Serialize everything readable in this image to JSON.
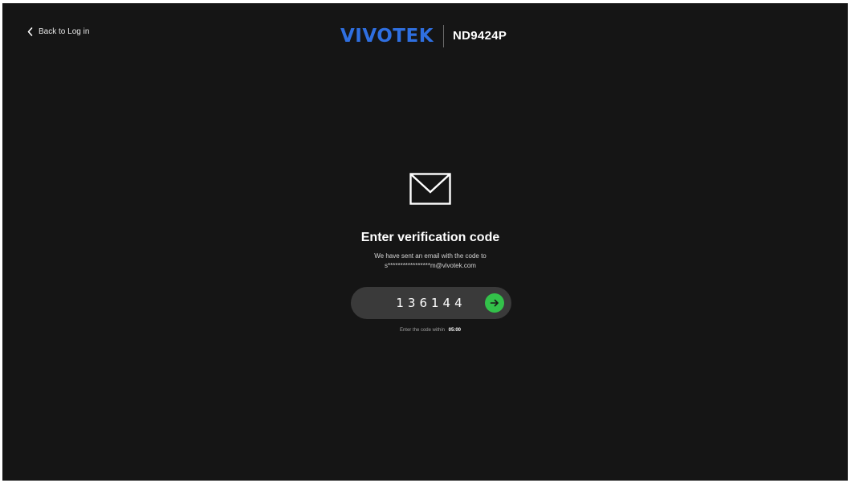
{
  "nav": {
    "back_label": "Back to Log in",
    "back_icon": "chevron-left-icon"
  },
  "header": {
    "brand": "VIVOTEK",
    "model": "ND9424P",
    "brand_color": "#2f6fe0"
  },
  "verification": {
    "icon": "envelope-icon",
    "title": "Enter verification code",
    "message_line1": "We have sent an email with the code to",
    "message_line2": "s*****************m@vivotek.com",
    "code_value": "136144",
    "submit_icon": "arrow-right-icon",
    "submit_color": "#33c14a",
    "timer_label": "Enter the code within",
    "timer_value": "05:00"
  },
  "colors": {
    "background": "#151515",
    "input_background": "#3a3a3a"
  }
}
